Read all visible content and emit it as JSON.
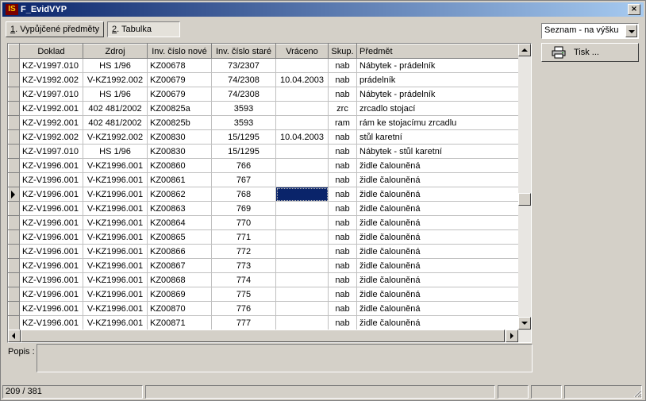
{
  "window": {
    "title": "F_EvidVYP",
    "app_icon_text": "IS",
    "close_label": "×"
  },
  "tabs": [
    {
      "num": "1",
      "label": ". Vypůjčené předměty"
    },
    {
      "num": "2",
      "label": ". Tabulka"
    }
  ],
  "view_select": {
    "value": "Seznam - na výšku"
  },
  "print_button": {
    "label": "Tisk ..."
  },
  "table": {
    "columns": [
      "Doklad",
      "Zdroj",
      "Inv. číslo nové",
      "Inv. číslo staré",
      "Vráceno",
      "Skup.",
      "Předmět"
    ],
    "rows": [
      [
        "KZ-V1997.010",
        "HS 1/96",
        "KZ00678",
        "73/2307",
        "",
        "nab",
        "Nábytek - prádelník"
      ],
      [
        "KZ-V1992.002",
        "V-KZ1992.002",
        "KZ00679",
        "74/2308",
        "10.04.2003",
        "nab",
        "prádelník"
      ],
      [
        "KZ-V1997.010",
        "HS 1/96",
        "KZ00679",
        "74/2308",
        "",
        "nab",
        "Nábytek - prádelník"
      ],
      [
        "KZ-V1992.001",
        "402 481/2002",
        "KZ00825a",
        "3593",
        "",
        "zrc",
        "zrcadlo stojací"
      ],
      [
        "KZ-V1992.001",
        "402 481/2002",
        "KZ00825b",
        "3593",
        "",
        "ram",
        "rám ke stojacímu zrcadlu"
      ],
      [
        "KZ-V1992.002",
        "V-KZ1992.002",
        "KZ00830",
        "15/1295",
        "10.04.2003",
        "nab",
        "stůl karetní"
      ],
      [
        "KZ-V1997.010",
        "HS 1/96",
        "KZ00830",
        "15/1295",
        "",
        "nab",
        "Nábytek - stůl karetní"
      ],
      [
        "KZ-V1996.001",
        "V-KZ1996.001",
        "KZ00860",
        "766",
        "",
        "nab",
        "židle čalouněná"
      ],
      [
        "KZ-V1996.001",
        "V-KZ1996.001",
        "KZ00861",
        "767",
        "",
        "nab",
        "židle čalouněná"
      ],
      [
        "KZ-V1996.001",
        "V-KZ1996.001",
        "KZ00862",
        "768",
        "",
        "nab",
        "židle čalouněná"
      ],
      [
        "KZ-V1996.001",
        "V-KZ1996.001",
        "KZ00863",
        "769",
        "",
        "nab",
        "židle čalouněná"
      ],
      [
        "KZ-V1996.001",
        "V-KZ1996.001",
        "KZ00864",
        "770",
        "",
        "nab",
        "židle čalouněná"
      ],
      [
        "KZ-V1996.001",
        "V-KZ1996.001",
        "KZ00865",
        "771",
        "",
        "nab",
        "židle čalouněná"
      ],
      [
        "KZ-V1996.001",
        "V-KZ1996.001",
        "KZ00866",
        "772",
        "",
        "nab",
        "židle čalouněná"
      ],
      [
        "KZ-V1996.001",
        "V-KZ1996.001",
        "KZ00867",
        "773",
        "",
        "nab",
        "židle čalouněná"
      ],
      [
        "KZ-V1996.001",
        "V-KZ1996.001",
        "KZ00868",
        "774",
        "",
        "nab",
        "židle čalouněná"
      ],
      [
        "KZ-V1996.001",
        "V-KZ1996.001",
        "KZ00869",
        "775",
        "",
        "nab",
        "židle čalouněná"
      ],
      [
        "KZ-V1996.001",
        "V-KZ1996.001",
        "KZ00870",
        "776",
        "",
        "nab",
        "židle čalouněná"
      ],
      [
        "KZ-V1996.001",
        "V-KZ1996.001",
        "KZ00871",
        "777",
        "",
        "nab",
        "židle čalouněná"
      ]
    ],
    "current_row": 9,
    "selected_cell": "Vráceno"
  },
  "popis": {
    "label": "Popis :"
  },
  "status": {
    "record": "209 / 381"
  }
}
